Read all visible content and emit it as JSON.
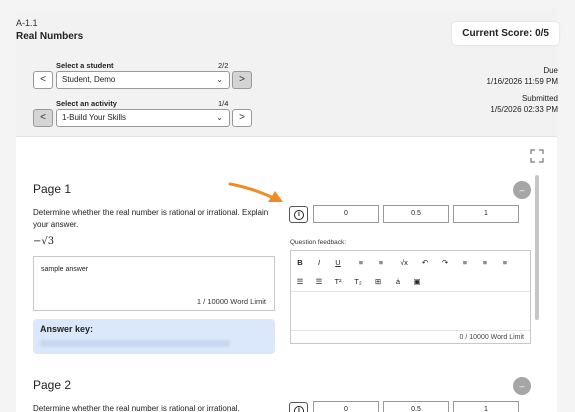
{
  "header": {
    "code": "A-1.1",
    "title": "Real Numbers",
    "score_label": "Current Score:",
    "score_value": "0/5",
    "student_label": "Select a student",
    "student_count": "2/2",
    "student_value": "Student, Demo",
    "activity_label": "Select an activity",
    "activity_count": "1/4",
    "activity_value": "1-Build Your Skills",
    "due_label": "Due",
    "due_date": "1/16/2026 11:59 PM",
    "submitted_label": "Submitted",
    "submitted_date": "1/5/2026 02:33 PM",
    "prev_symbol": "<",
    "next_symbol": ">",
    "chevron": "⌄"
  },
  "pages": [
    {
      "title": "Page 1",
      "prompt": "Determine whether the real number is rational or irrational. Explain your answer.",
      "math": "−√3",
      "answer": "sample answer",
      "word_limit": "1 / 10000 Word Limit",
      "answer_key_label": "Answer key:",
      "score_options": [
        "0",
        "0.5",
        "1"
      ],
      "feedback_label": "Question feedback:",
      "feedback_word_limit": "0 / 10000 Word Limit"
    },
    {
      "title": "Page 2",
      "prompt": "Determine whether the real number is rational or irrational.",
      "score_options": [
        "0",
        "0.5",
        "1"
      ]
    }
  ],
  "toolbar": {
    "row1": [
      "B",
      "I",
      "U",
      "≡",
      "≡",
      "√x",
      "↶",
      "↷",
      "≡",
      "≡",
      "≡"
    ],
    "row2": [
      "☰",
      "☰",
      "T²",
      "T₂",
      "⊞",
      "á",
      "▣"
    ]
  },
  "colors": {
    "arrow": "#f08c22",
    "answer_key_bg": "#dbe8fb"
  }
}
